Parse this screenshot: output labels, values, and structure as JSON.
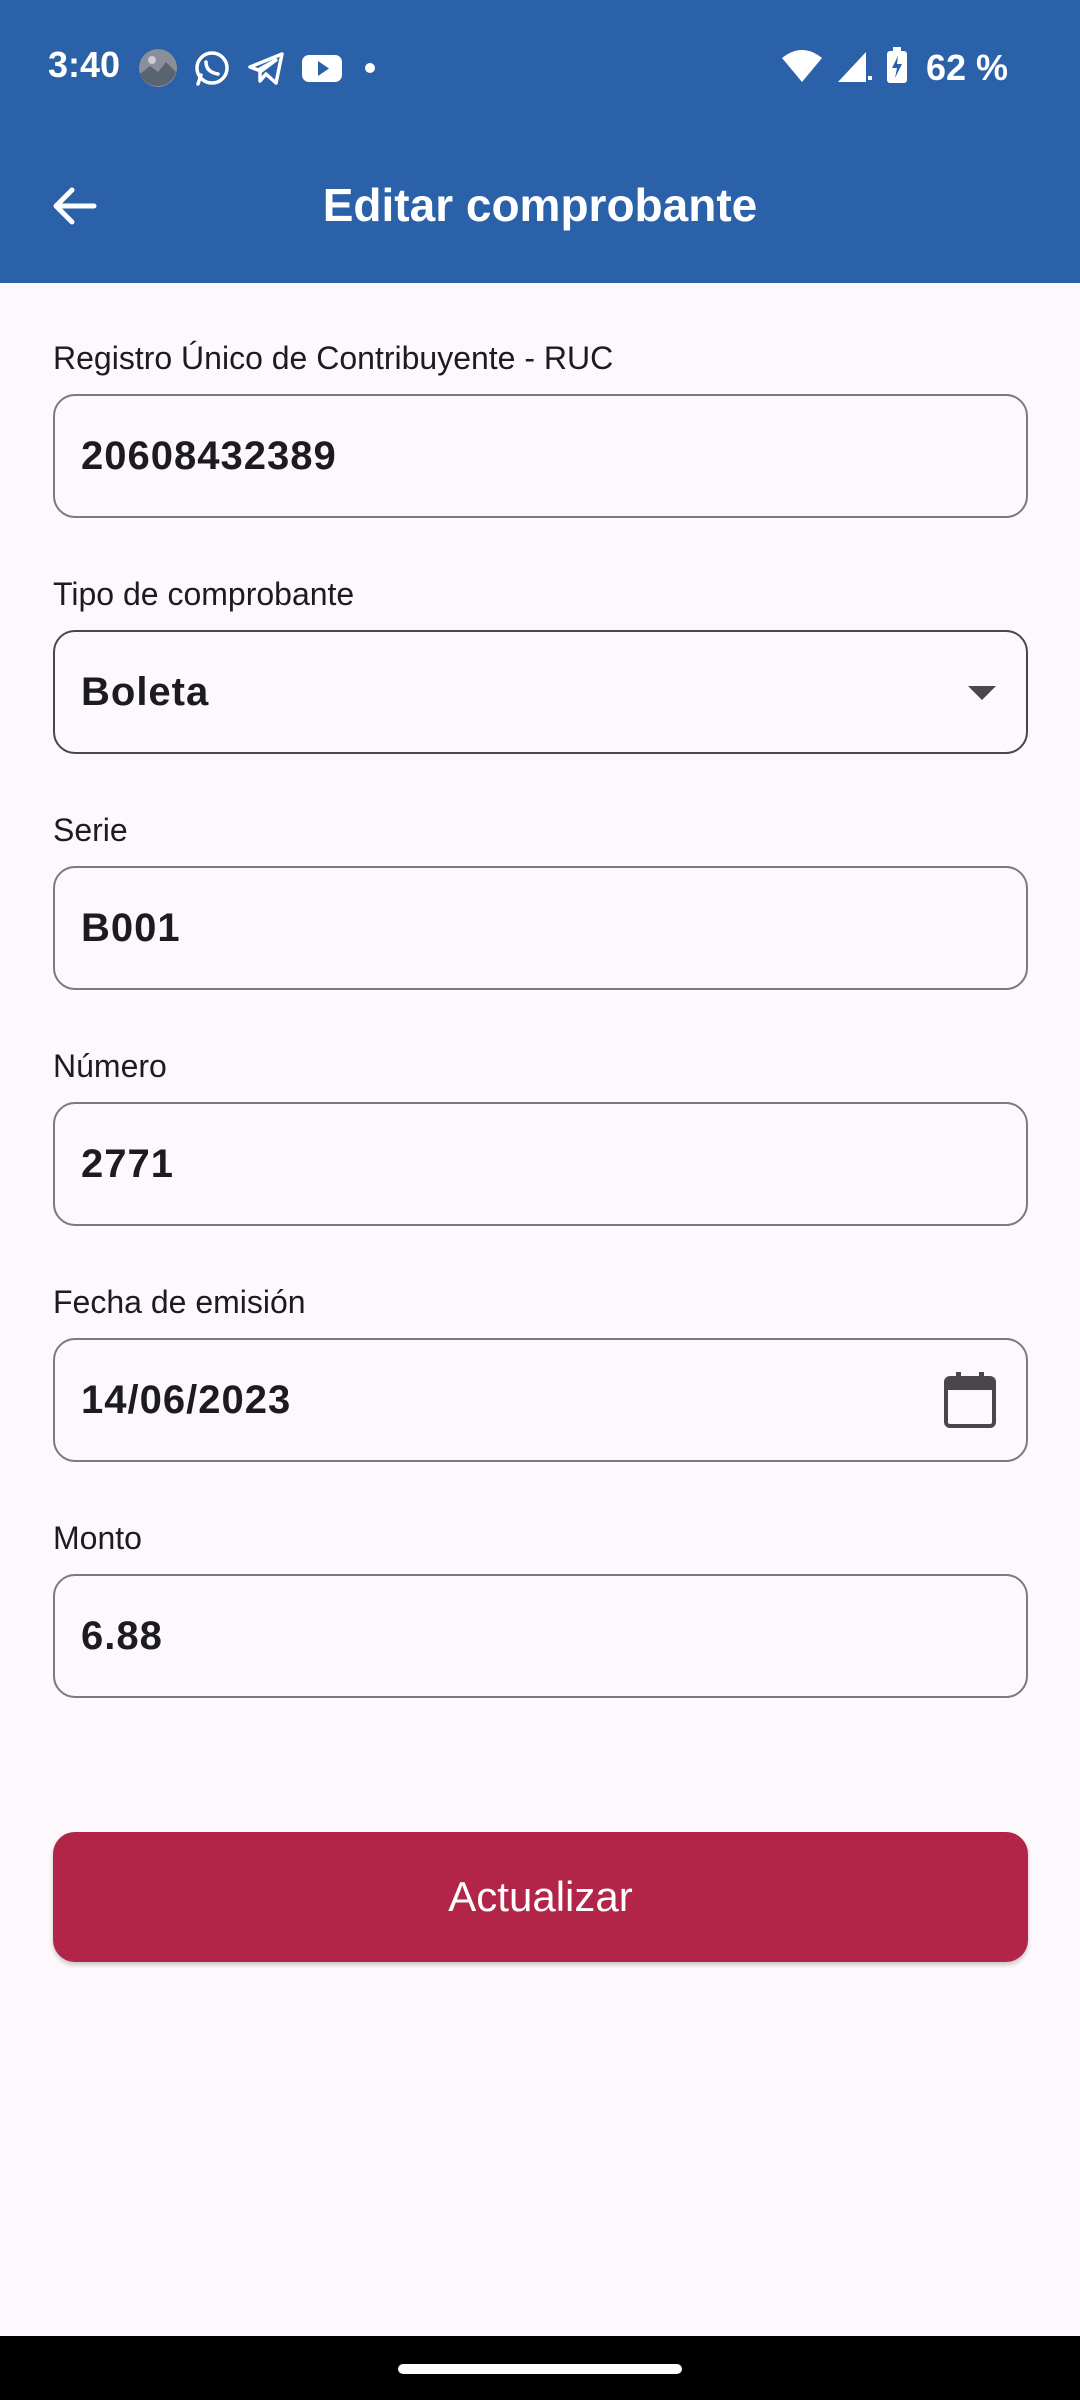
{
  "status_bar": {
    "time": "3:40",
    "battery_text": "62 %",
    "icons_left": [
      "photo-avatar-icon",
      "whatsapp-icon",
      "telegram-icon",
      "youtube-icon",
      "dot-icon"
    ],
    "icons_right": [
      "wifi-icon",
      "signal-icon",
      "battery-charging-icon"
    ]
  },
  "app_bar": {
    "title": "Editar comprobante",
    "back_icon": "arrow-left-icon",
    "background_color": "#2b61a9"
  },
  "form": {
    "ruc": {
      "label": "Registro Único de Contribuyente - RUC",
      "value": "20608432389"
    },
    "tipo": {
      "label": "Tipo de comprobante",
      "value": "Boleta",
      "trailing_icon": "dropdown-arrow-icon"
    },
    "serie": {
      "label": "Serie",
      "value": "B001"
    },
    "numero": {
      "label": "Número",
      "value": "2771"
    },
    "fecha": {
      "label": "Fecha de emisión",
      "value": "14/06/2023",
      "trailing_icon": "calendar-icon"
    },
    "monto": {
      "label": "Monto",
      "value": "6.88"
    }
  },
  "actions": {
    "update_label": "Actualizar",
    "update_color": "#b22448"
  }
}
